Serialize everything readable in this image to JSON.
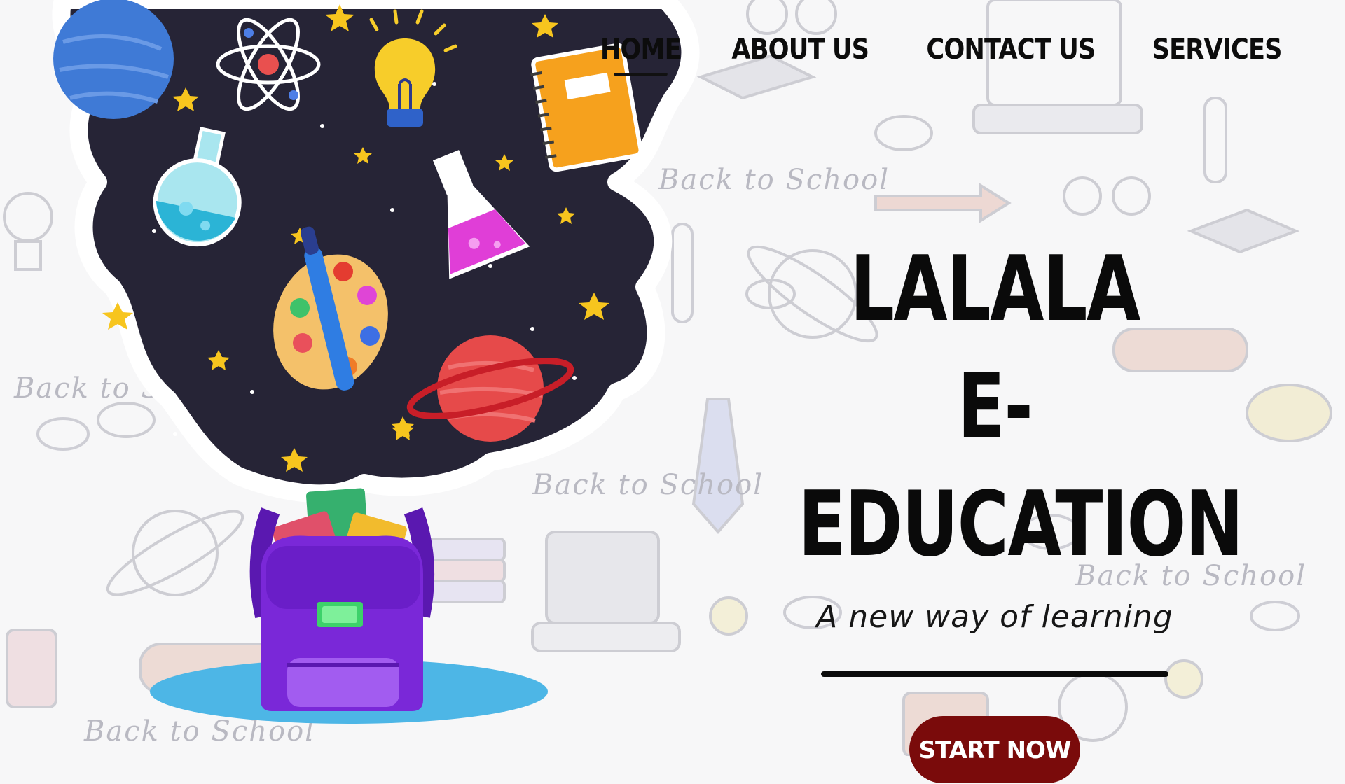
{
  "nav": {
    "items": [
      {
        "label": "HOME",
        "active": true
      },
      {
        "label": "ABOUT US",
        "active": false
      },
      {
        "label": "CONTACT US",
        "active": false
      },
      {
        "label": "SERVICES",
        "active": false
      }
    ]
  },
  "hero": {
    "title_line1": "LALALA",
    "title_line2": "E-EDUCATION",
    "tagline": "A new way of learning",
    "cta_label": "START NOW"
  },
  "background": {
    "doodle_caption": "Back to School"
  },
  "colors": {
    "cta": "#7a0b0b",
    "space": "#262436",
    "backpack": "#7a28d8",
    "text": "#0a0a0a"
  },
  "icons": [
    "atom-icon",
    "lightbulb-icon",
    "notebook-icon",
    "flask-icon",
    "palette-icon",
    "planet-icon",
    "backpack-icon",
    "laptop-icon",
    "graduation-cap-icon"
  ]
}
